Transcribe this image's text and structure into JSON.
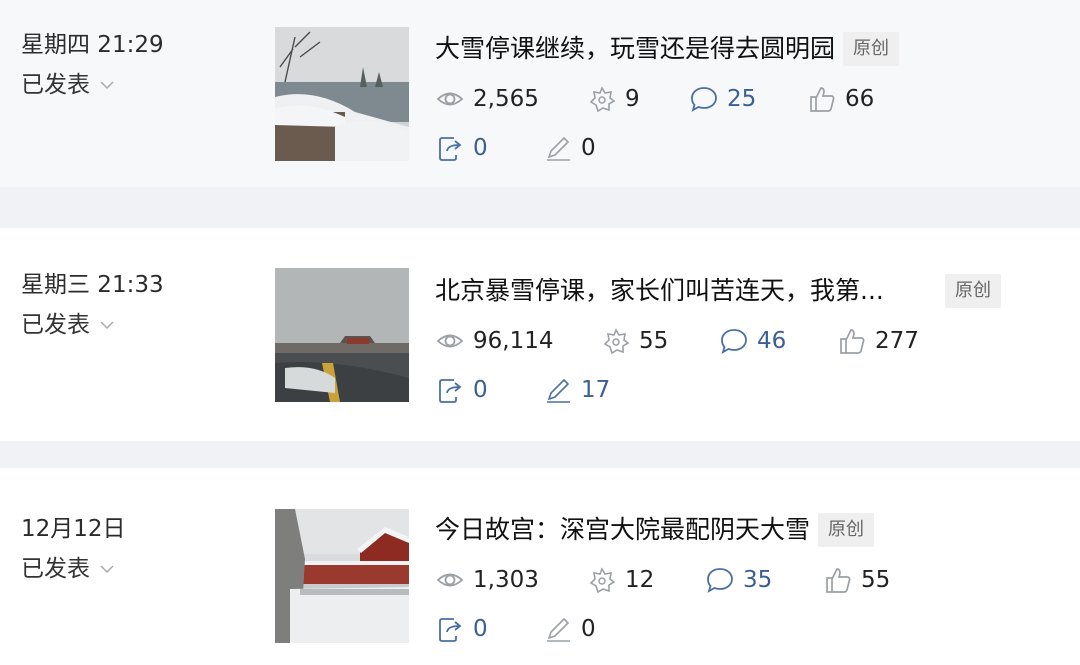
{
  "articles": [
    {
      "date": "星期四 21:29",
      "status": "已发表",
      "title": "大雪停课继续，玩雪还是得去圆明园",
      "tag": "原创",
      "views": "2,565",
      "stars": "9",
      "comments": "25",
      "likes": "66",
      "shares": "0",
      "edits": "0"
    },
    {
      "date": "星期三 21:33",
      "status": "已发表",
      "title": "北京暴雪停课，家长们叫苦连天，我第...",
      "tag": "原创",
      "views": "96,114",
      "stars": "55",
      "comments": "46",
      "likes": "277",
      "shares": "0",
      "edits": "17"
    },
    {
      "date": "12月12日",
      "status": "已发表",
      "title": "今日故宫：深宫大院最配阴天大雪",
      "tag": "原创",
      "views": "1,303",
      "stars": "12",
      "comments": "35",
      "likes": "55",
      "shares": "0",
      "edits": "0"
    }
  ],
  "colors": {
    "accent": "#3b5f94",
    "icon_gray": "#9aa0a6",
    "background": "#f1f2f5"
  }
}
